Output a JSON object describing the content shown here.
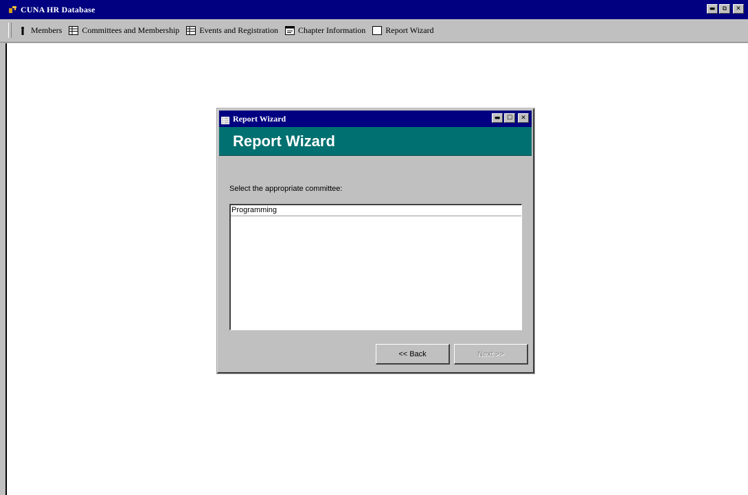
{
  "app": {
    "title": "CUNA HR Database",
    "window_controls": [
      "minimize",
      "maximize",
      "close"
    ]
  },
  "menubar": {
    "items": [
      {
        "label": "Members",
        "icon": "person-icon"
      },
      {
        "label": "Committees and Membership",
        "icon": "grid-icon"
      },
      {
        "label": "Events and Registration",
        "icon": "grid-icon"
      },
      {
        "label": "Chapter Information",
        "icon": "form-icon"
      },
      {
        "label": "Report Wizard",
        "icon": "report-icon"
      }
    ]
  },
  "dialog": {
    "title": "Report Wizard",
    "banner": "Report Wizard",
    "prompt": "Select the appropriate committee:",
    "list_items": [
      "Programming"
    ],
    "buttons": {
      "back": "<< Back",
      "next": "Next >>"
    },
    "banner_color": "#007070",
    "titlebar_color": "#000080"
  }
}
